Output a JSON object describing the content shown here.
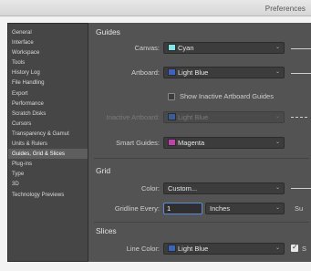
{
  "window": {
    "title": "Preferences"
  },
  "sidebar": {
    "items": [
      {
        "label": "General"
      },
      {
        "label": "Interface"
      },
      {
        "label": "Workspace"
      },
      {
        "label": "Tools"
      },
      {
        "label": "History Log"
      },
      {
        "label": "File Handling"
      },
      {
        "label": "Export"
      },
      {
        "label": "Performance"
      },
      {
        "label": "Scratch Disks"
      },
      {
        "label": "Cursors"
      },
      {
        "label": "Transparency & Gamut"
      },
      {
        "label": "Units & Rulers"
      },
      {
        "label": "Guides, Grid & Slices",
        "active": true
      },
      {
        "label": "Plug-ins"
      },
      {
        "label": "Type"
      },
      {
        "label": "3D"
      },
      {
        "label": "Technology Previews"
      }
    ]
  },
  "guides": {
    "heading": "Guides",
    "canvas": {
      "label": "Canvas:",
      "value": "Cyan",
      "color": "#7fe6ec"
    },
    "artboard": {
      "label": "Artboard:",
      "value": "Light Blue",
      "color": "#3b63c4"
    },
    "show_inactive": {
      "label": "Show Inactive Artboard Guides",
      "checked": false
    },
    "inactive_artboard": {
      "label": "Inactive Artboard:",
      "value": "Light Blue",
      "color": "#3b5c98"
    },
    "smart_guides": {
      "label": "Smart Guides:",
      "value": "Magenta",
      "color": "#c53fae"
    }
  },
  "grid": {
    "heading": "Grid",
    "color": {
      "label": "Color:",
      "value": "Custom..."
    },
    "gridline_every": {
      "label": "Gridline Every:",
      "value": "1",
      "unit": "Inches"
    },
    "subdivisions_cut": "Su"
  },
  "slices": {
    "heading": "Slices",
    "line_color": {
      "label": "Line Color:",
      "value": "Light Blue",
      "color": "#3b63c4"
    },
    "show_numbers_cut": "S",
    "checked": true
  },
  "colors": {
    "panel": "#535353",
    "sidebar": "#464646",
    "selected": "#5e5e5e"
  }
}
